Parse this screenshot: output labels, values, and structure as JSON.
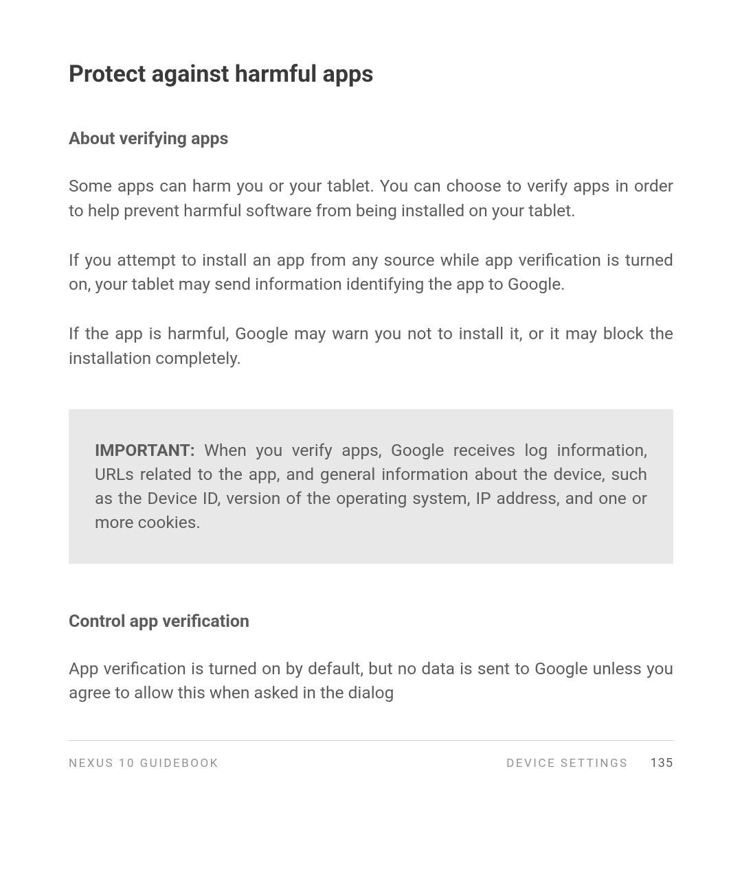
{
  "title": "Protect against harmful apps",
  "section1": {
    "heading": "About verifying apps",
    "p1": "Some apps can harm you or your tablet. You can choose to verify apps in order to help prevent harmful software from being installed on your tablet.",
    "p2": "If you attempt to install an app from any source while app verification is turned on, your tablet may send information identifying the app to Google.",
    "p3": "If the app is harmful, Google may warn you not to install it, or it may block the installation completely."
  },
  "callout": {
    "label": "IMPORTANT:",
    "text": " When you verify apps, Google receives log information, URLs related to the app, and general information about the device, such as the Device ID, version of the operating system, IP address, and one or more cookies."
  },
  "section2": {
    "heading": "Control app verification",
    "p1": "App verification is turned on by default, but no data is sent to Google unless you agree to allow this when asked in the dialog"
  },
  "footer": {
    "left": "NEXUS 10 GUIDEBOOK",
    "right": "DEVICE SETTINGS",
    "page": "135"
  }
}
